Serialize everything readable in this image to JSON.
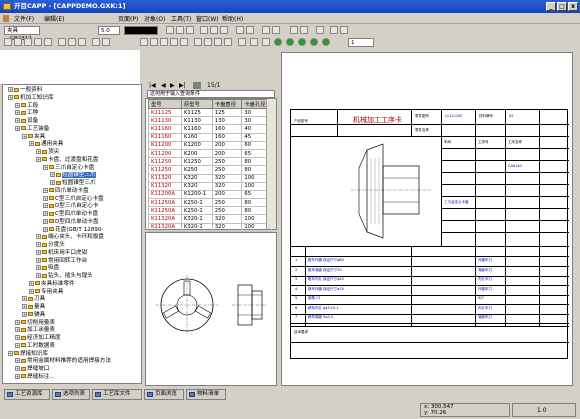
{
  "window": {
    "title": "开目CAPP - [CAPPDEMO.GXK:1]",
    "min": "_",
    "max": "□",
    "close": "x"
  },
  "menu": [
    "文件(F)",
    "编辑(E)",
    "页面(P)",
    "对象(O)",
    "工具(T)",
    "窗口(W)",
    "帮助(H)"
  ],
  "toolbar": {
    "font_size": "5.0",
    "doc_combo": "夹具_GB2312"
  },
  "table_nav": {
    "page": "15/1",
    "filter_hint": "这何用于输入查询条件"
  },
  "table": {
    "headers": [
      "型号",
      "原型号",
      "卡盘直径",
      "卡盘孔径"
    ],
    "rows": [
      [
        "K11125",
        "K1125",
        "125",
        "30"
      ],
      [
        "K11130",
        "K1130",
        "130",
        "30"
      ],
      [
        "K11160",
        "K1160",
        "160",
        "40"
      ],
      [
        "K11160",
        "K160",
        "160",
        "45"
      ],
      [
        "K11200",
        "K1200",
        "200",
        "60"
      ],
      [
        "K11200",
        "K200",
        "200",
        "65"
      ],
      [
        "K11250",
        "K1250",
        "250",
        "80"
      ],
      [
        "K11250",
        "K250",
        "250",
        "80"
      ],
      [
        "K11320",
        "K320",
        "320",
        "100"
      ],
      [
        "K11320",
        "K320",
        "320",
        "100"
      ],
      [
        "K11200A",
        "K1200-1",
        "200",
        "65"
      ],
      [
        "K11250A",
        "K250-1",
        "250",
        "80"
      ],
      [
        "K11250A",
        "K250-1",
        "250",
        "80"
      ],
      [
        "K11320A",
        "K320-1",
        "320",
        "100"
      ],
      [
        "K11320A",
        "K320-1",
        "320",
        "100"
      ]
    ]
  },
  "tree": [
    {
      "label": "一般资料",
      "indent": 1
    },
    {
      "label": "机加工知识库",
      "indent": 1
    },
    {
      "label": "工段",
      "indent": 2
    },
    {
      "label": "工种",
      "indent": 2
    },
    {
      "label": "设备",
      "indent": 2
    },
    {
      "label": "工艺装备",
      "indent": 2
    },
    {
      "label": "夹具",
      "indent": 3
    },
    {
      "label": "通用夹具",
      "indent": 4
    },
    {
      "label": "顶尖",
      "indent": 5
    },
    {
      "label": "卡盘、过渡盘和花盘",
      "indent": 5
    },
    {
      "label": "三爪自定心卡盘",
      "indent": 6
    },
    {
      "label": "短圆锥型三爪",
      "indent": 7,
      "selected": true
    },
    {
      "label": "短圆锥型三爪",
      "indent": 7
    },
    {
      "label": "四爪单动卡盘",
      "indent": 6
    },
    {
      "label": "C型三爪自定心卡盘",
      "indent": 6
    },
    {
      "label": "D型三爪自定心卡",
      "indent": 6
    },
    {
      "label": "C型四爪单动卡盘",
      "indent": 6
    },
    {
      "label": "D型四爪单动卡盘",
      "indent": 6
    },
    {
      "label": "花盘(GB/T 12890-",
      "indent": 6
    },
    {
      "label": "端心夹头、卡环和拔盘",
      "indent": 5
    },
    {
      "label": "分度头",
      "indent": 5
    },
    {
      "label": "机床用平口虎钳",
      "indent": 5
    },
    {
      "label": "常用回转工作台",
      "indent": 5
    },
    {
      "label": "吸盘",
      "indent": 5
    },
    {
      "label": "钻头、插头与镗头",
      "indent": 5
    },
    {
      "label": "夹具标准零件",
      "indent": 4
    },
    {
      "label": "专用夹具",
      "indent": 4
    },
    {
      "label": "刀具",
      "indent": 3
    },
    {
      "label": "量具",
      "indent": 3
    },
    {
      "label": "辅具",
      "indent": 3
    },
    {
      "label": "切削用量表",
      "indent": 2
    },
    {
      "label": "加工余量表",
      "indent": 2
    },
    {
      "label": "经济加工精度",
      "indent": 2
    },
    {
      "label": "工时数据表",
      "indent": 2
    },
    {
      "label": "焊接知识库",
      "indent": 1
    },
    {
      "label": "常用金属材料推荐的适用焊接方法",
      "indent": 2
    },
    {
      "label": "焊缝坡口",
      "indent": 2
    },
    {
      "label": "焊缝标注...",
      "indent": 2
    }
  ],
  "tabs": [
    "工艺资源库",
    "选项列表",
    "工艺库文件",
    "页面浏览",
    "物料清单"
  ],
  "status": {
    "x": "x: 300.547",
    "y": "y: 70.26",
    "zoom": "1.0"
  },
  "form": {
    "title": "机械加工工序卡",
    "product_model": "产品型号",
    "part_no": "零件图号",
    "part_name": "零件名称",
    "material": "材料牌号",
    "workshop": "车间",
    "process_name": "工序名称",
    "process_no": "工序号",
    "material_val": "45",
    "part_no_val": "CJ-10-045",
    "machine": "CA6140",
    "fixture": "三爪自定心卡盘",
    "steps": [
      "粗车外圆 保证尺寸φ80",
      "粗车端面 保证尺寸30",
      "粗车内孔 保证尺寸φ45",
      "精车外圆 保证尺寸φ78",
      "倒角 C1",
      "精车内孔 φ45±0.1",
      "精车端面 Ra3.2"
    ],
    "tools": [
      "外圆车刀",
      "端面车刀",
      "内孔车刀",
      "外圆车刀",
      "90°",
      "内孔车刀",
      "端面车刀"
    ],
    "note": "技术要求"
  },
  "colors": {
    "title_blue": "#2a5fd8",
    "selection": "#316ac5",
    "form_red": "#b00000"
  }
}
